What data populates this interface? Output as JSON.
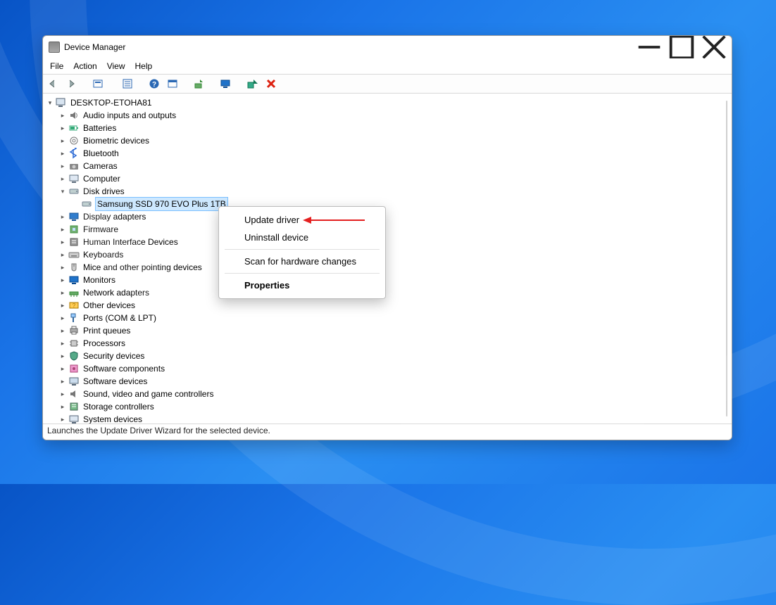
{
  "window": {
    "title": "Device Manager",
    "buttons": {
      "minimize": "Minimize",
      "maximize": "Maximize",
      "close": "Close"
    }
  },
  "menubar": {
    "file": "File",
    "action": "Action",
    "view": "View",
    "help": "Help"
  },
  "toolbar": {
    "back": "Back",
    "forward": "Forward",
    "show_hidden": "Show hidden",
    "properties": "Properties",
    "help": "Help",
    "refresh": "Refresh",
    "update": "Update driver",
    "scan": "Scan for hardware changes",
    "enable": "Enable device",
    "uninstall": "Uninstall device"
  },
  "tree": {
    "root": "DESKTOP-ETOHA81",
    "items": [
      "Audio inputs and outputs",
      "Batteries",
      "Biometric devices",
      "Bluetooth",
      "Cameras",
      "Computer",
      "Disk drives",
      "Display adapters",
      "Firmware",
      "Human Interface Devices",
      "Keyboards",
      "Mice and other pointing devices",
      "Monitors",
      "Network adapters",
      "Other devices",
      "Ports (COM & LPT)",
      "Print queues",
      "Processors",
      "Security devices",
      "Software components",
      "Software devices",
      "Sound, video and game controllers",
      "Storage controllers",
      "System devices"
    ],
    "disk_child": "Samsung SSD 970 EVO Plus 1TB"
  },
  "context_menu": {
    "update": "Update driver",
    "uninstall": "Uninstall device",
    "scan": "Scan for hardware changes",
    "properties": "Properties"
  },
  "statusbar": "Launches the Update Driver Wizard for the selected device."
}
